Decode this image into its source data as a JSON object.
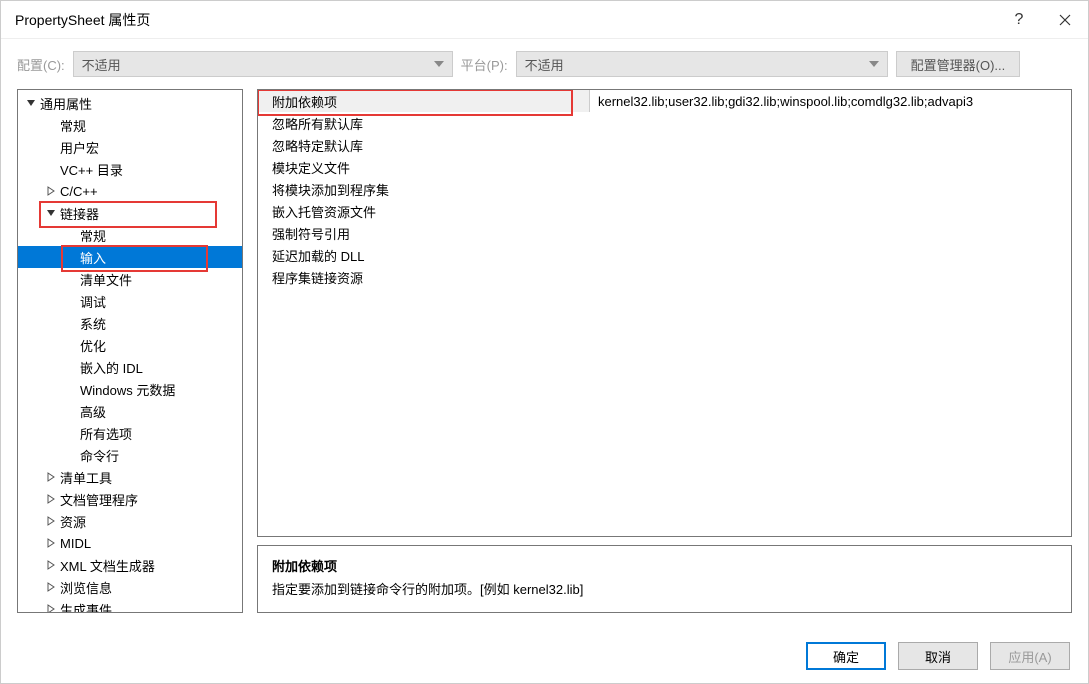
{
  "title": "PropertySheet 属性页",
  "toolbar": {
    "config_label": "配置(C):",
    "config_value": "不适用",
    "platform_label": "平台(P):",
    "platform_value": "不适用",
    "cfgmgr_label": "配置管理器(O)..."
  },
  "tree": [
    {
      "label": "通用属性",
      "depth": 0,
      "arrow": "down"
    },
    {
      "label": "常规",
      "depth": 1
    },
    {
      "label": "用户宏",
      "depth": 1
    },
    {
      "label": "VC++ 目录",
      "depth": 1
    },
    {
      "label": "C/C++",
      "depth": 1,
      "arrow": "right"
    },
    {
      "label": "链接器",
      "depth": 1,
      "arrow": "down",
      "hl": "wide"
    },
    {
      "label": "常规",
      "depth": 2
    },
    {
      "label": "输入",
      "depth": 2,
      "selected": true,
      "hl": "sel"
    },
    {
      "label": "清单文件",
      "depth": 2
    },
    {
      "label": "调试",
      "depth": 2
    },
    {
      "label": "系统",
      "depth": 2
    },
    {
      "label": "优化",
      "depth": 2
    },
    {
      "label": "嵌入的 IDL",
      "depth": 2
    },
    {
      "label": "Windows 元数据",
      "depth": 2
    },
    {
      "label": "高级",
      "depth": 2
    },
    {
      "label": "所有选项",
      "depth": 2
    },
    {
      "label": "命令行",
      "depth": 2
    },
    {
      "label": "清单工具",
      "depth": 1,
      "arrow": "right"
    },
    {
      "label": "文档管理程序",
      "depth": 1,
      "arrow": "right"
    },
    {
      "label": "资源",
      "depth": 1,
      "arrow": "right"
    },
    {
      "label": "MIDL",
      "depth": 1,
      "arrow": "right"
    },
    {
      "label": "XML 文档生成器",
      "depth": 1,
      "arrow": "right"
    },
    {
      "label": "浏览信息",
      "depth": 1,
      "arrow": "right"
    },
    {
      "label": "生成事件",
      "depth": 1,
      "arrow": "right"
    }
  ],
  "grid": [
    {
      "key": "附加依赖项",
      "val": "kernel32.lib;user32.lib;gdi32.lib;winspool.lib;comdlg32.lib;advapi3",
      "sel": true
    },
    {
      "key": "忽略所有默认库",
      "val": ""
    },
    {
      "key": "忽略特定默认库",
      "val": ""
    },
    {
      "key": "模块定义文件",
      "val": ""
    },
    {
      "key": "将模块添加到程序集",
      "val": ""
    },
    {
      "key": "嵌入托管资源文件",
      "val": ""
    },
    {
      "key": "强制符号引用",
      "val": ""
    },
    {
      "key": "延迟加载的 DLL",
      "val": ""
    },
    {
      "key": "程序集链接资源",
      "val": ""
    }
  ],
  "desc": {
    "title": "附加依赖项",
    "text": "指定要添加到链接命令行的附加项。[例如 kernel32.lib]"
  },
  "buttons": {
    "ok": "确定",
    "cancel": "取消",
    "apply": "应用(A)"
  }
}
